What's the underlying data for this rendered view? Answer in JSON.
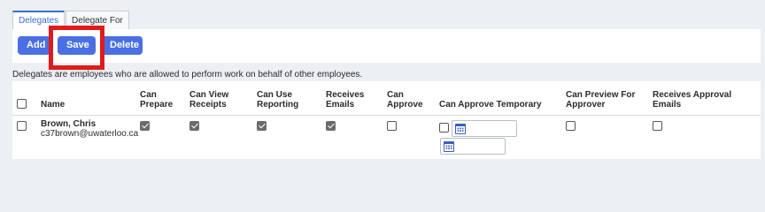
{
  "tabs": [
    {
      "label": "Delegates",
      "active": true
    },
    {
      "label": "Delegate For",
      "active": false
    }
  ],
  "toolbar": {
    "add_label": "Add",
    "save_label": "Save",
    "delete_label": "Delete"
  },
  "description": "Delegates are employees who are allowed to perform work on behalf of other employees.",
  "table": {
    "headers": {
      "name": "Name",
      "can_prepare": [
        "Can",
        "Prepare"
      ],
      "can_view_receipts": [
        "Can View",
        "Receipts"
      ],
      "can_use_reporting": [
        "Can Use",
        "Reporting"
      ],
      "receives_emails": [
        "Receives",
        "Emails"
      ],
      "can_approve": [
        "Can",
        "Approve"
      ],
      "can_approve_temporary": "Can Approve Temporary",
      "can_preview_for_approver": [
        "Can Preview For",
        "Approver"
      ],
      "receives_approval_emails": [
        "Receives Approval",
        "Emails"
      ]
    },
    "rows": [
      {
        "name": "Brown, Chris",
        "email": "c37brown@uwaterloo.ca",
        "selected": false,
        "can_prepare": true,
        "can_view_receipts": true,
        "can_use_reporting": true,
        "receives_emails": true,
        "can_approve": false,
        "can_approve_temporary": false,
        "temp_start_date": "",
        "temp_end_date": "",
        "can_preview_for_approver": false,
        "receives_approval_emails": false
      }
    ]
  },
  "colors": {
    "accent": "#4a6fe3",
    "highlight": "#e01b1b",
    "background": "#eceff3"
  }
}
